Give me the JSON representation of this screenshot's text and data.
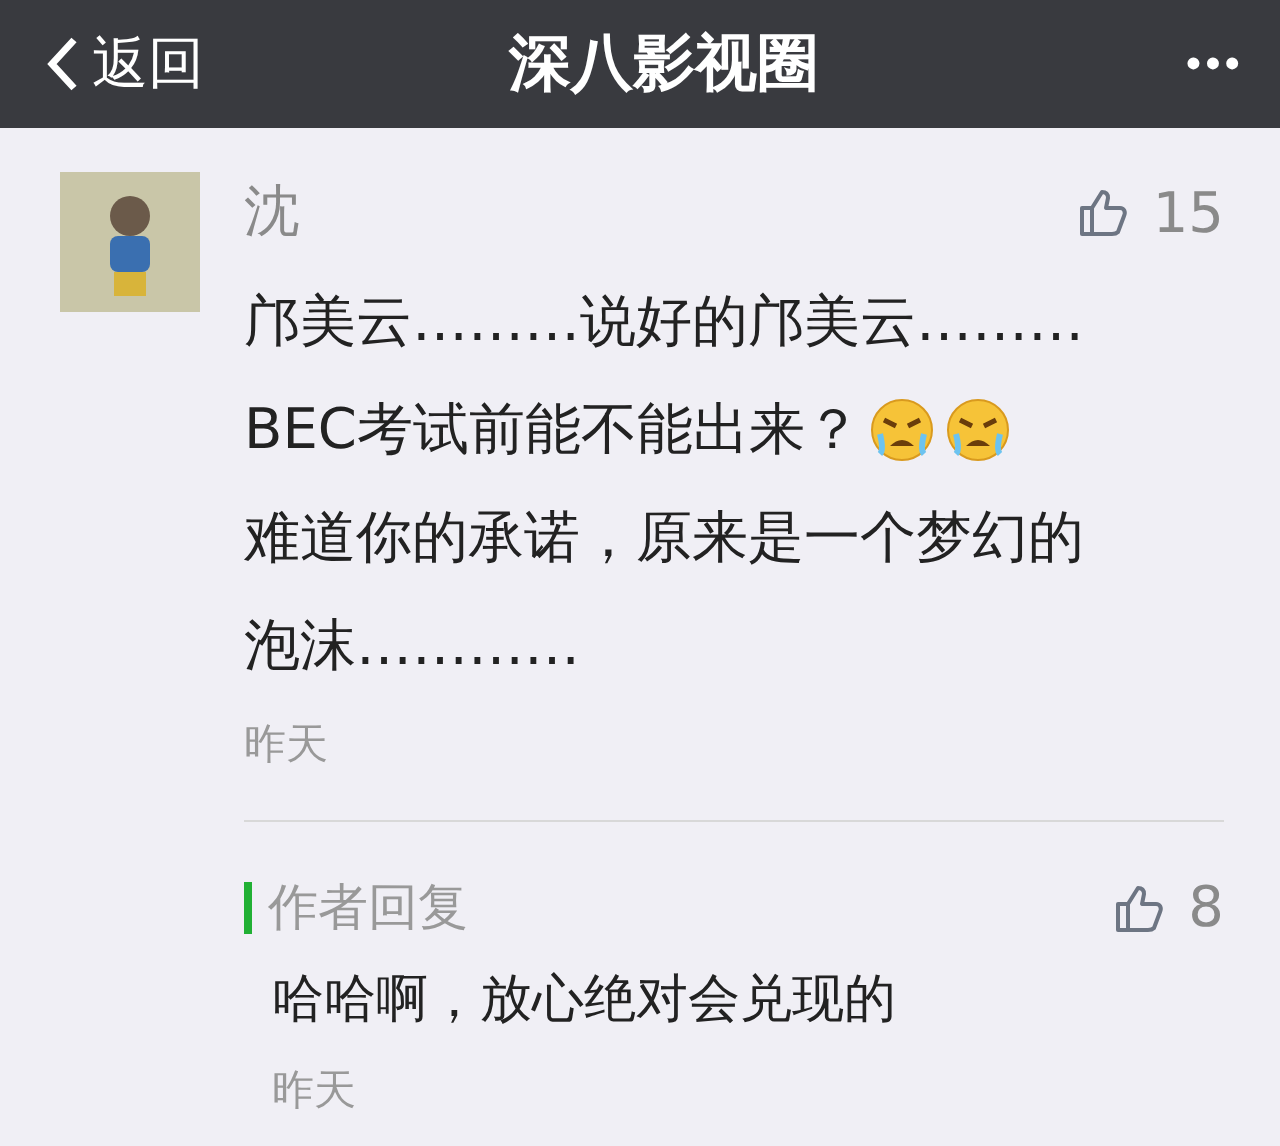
{
  "nav_bar": {
    "back_label": "返回",
    "title": "深八影视圈",
    "more": "•••"
  },
  "comment": {
    "author": "沈",
    "likes": "15",
    "text_lines": [
      "邝美云………说好的邝美云………",
      "BEC考试前能不能出来？"
    ],
    "emojis": [
      {
        "kind": "crying"
      },
      {
        "kind": "crying"
      }
    ],
    "text_after": "难道你的承诺，原来是一个梦幻的泡沫…………",
    "time": "昨天",
    "reply": {
      "label": "作者回复",
      "likes": "8",
      "text": "哈哈啊，放心绝对会兑现的",
      "time": "昨天"
    }
  }
}
